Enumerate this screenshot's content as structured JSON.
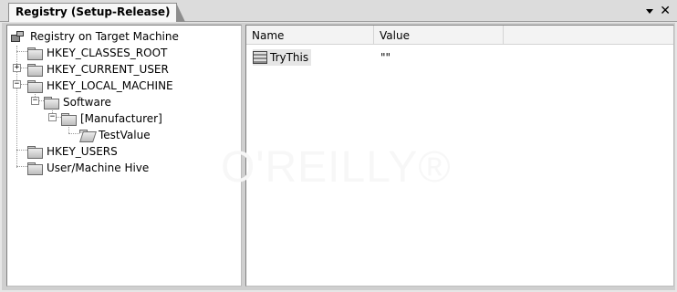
{
  "window": {
    "tab_title": "Registry (Setup-Release)",
    "dropdown_icon": "chevron-down-icon",
    "close_icon": "close-icon",
    "close_glyph": "✕"
  },
  "tree": {
    "root": "Registry on Target Machine",
    "nodes": [
      {
        "label": "HKEY_CLASSES_ROOT"
      },
      {
        "label": "HKEY_CURRENT_USER",
        "expander": "+"
      },
      {
        "label": "HKEY_LOCAL_MACHINE",
        "expander": "−"
      },
      {
        "label": "Software",
        "expander": "−"
      },
      {
        "label": "[Manufacturer]",
        "expander": "−"
      },
      {
        "label": "TestValue"
      },
      {
        "label": "HKEY_USERS"
      },
      {
        "label": "User/Machine Hive"
      }
    ]
  },
  "list": {
    "columns": [
      "Name",
      "Value"
    ],
    "rows": [
      {
        "name": "TryThis",
        "value": "\"\""
      }
    ]
  },
  "watermark": "O'REILLY®"
}
